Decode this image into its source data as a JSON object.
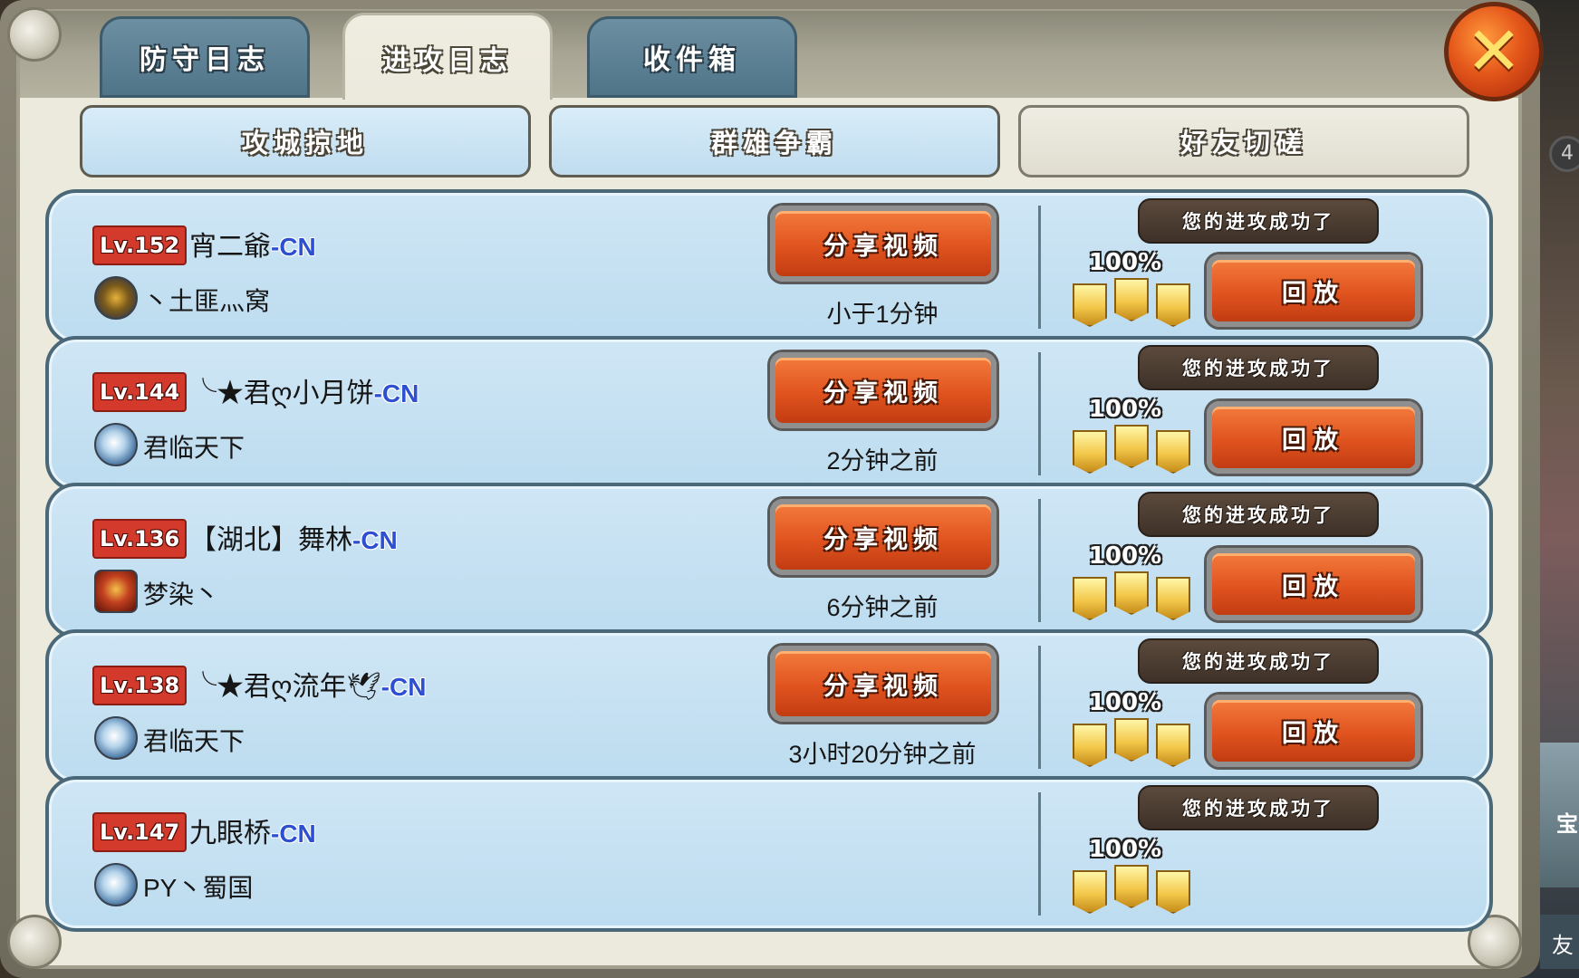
{
  "tabs": [
    {
      "label": "防守日志",
      "active": false
    },
    {
      "label": "进攻日志",
      "active": true
    },
    {
      "label": "收件箱",
      "active": false
    }
  ],
  "close_icon": "close-x-icon",
  "subtabs": [
    {
      "label": "攻城掠地",
      "style": "blue"
    },
    {
      "label": "群雄争霸",
      "style": "blue"
    },
    {
      "label": "好友切磋",
      "style": "grey"
    }
  ],
  "side_labels": {
    "top_number": "4",
    "bottom_char": "宝",
    "bottom_char2": "友"
  },
  "logs": [
    {
      "level": "Lv.152",
      "name": "宵二爺",
      "server": "-CN",
      "guild_icon": "dragon",
      "guild": "丶土匪灬窝",
      "share": "分享视频",
      "time": "小于1分钟",
      "result": "您的进攻成功了",
      "percent": "100%",
      "stars": 3,
      "replay": "回放"
    },
    {
      "level": "Lv.144",
      "name": "╰★君ღ小月饼",
      "server": "-CN",
      "guild_icon": "bird",
      "guild": "君临天下",
      "share": "分享视频",
      "time": "2分钟之前",
      "result": "您的进攻成功了",
      "percent": "100%",
      "stars": 3,
      "replay": "回放"
    },
    {
      "level": "Lv.136",
      "name": "【湖北】舞林",
      "server": "-CN",
      "guild_icon": "crest",
      "guild": "梦染丶",
      "share": "分享视频",
      "time": "6分钟之前",
      "result": "您的进攻成功了",
      "percent": "100%",
      "stars": 3,
      "replay": "回放"
    },
    {
      "level": "Lv.138",
      "name": "╰★君ღ流年🕊",
      "server": "-CN",
      "guild_icon": "bird",
      "guild": "君临天下",
      "share": "分享视频",
      "time": "3小时20分钟之前",
      "result": "您的进攻成功了",
      "percent": "100%",
      "stars": 3,
      "replay": "回放"
    },
    {
      "level": "Lv.147",
      "name": "九眼桥",
      "server": "-CN",
      "guild_icon": "bird",
      "guild": "PY丶蜀国",
      "share": "",
      "time": "",
      "result": "您的进攻成功了",
      "percent": "100%",
      "stars": 3,
      "replay": ""
    }
  ]
}
